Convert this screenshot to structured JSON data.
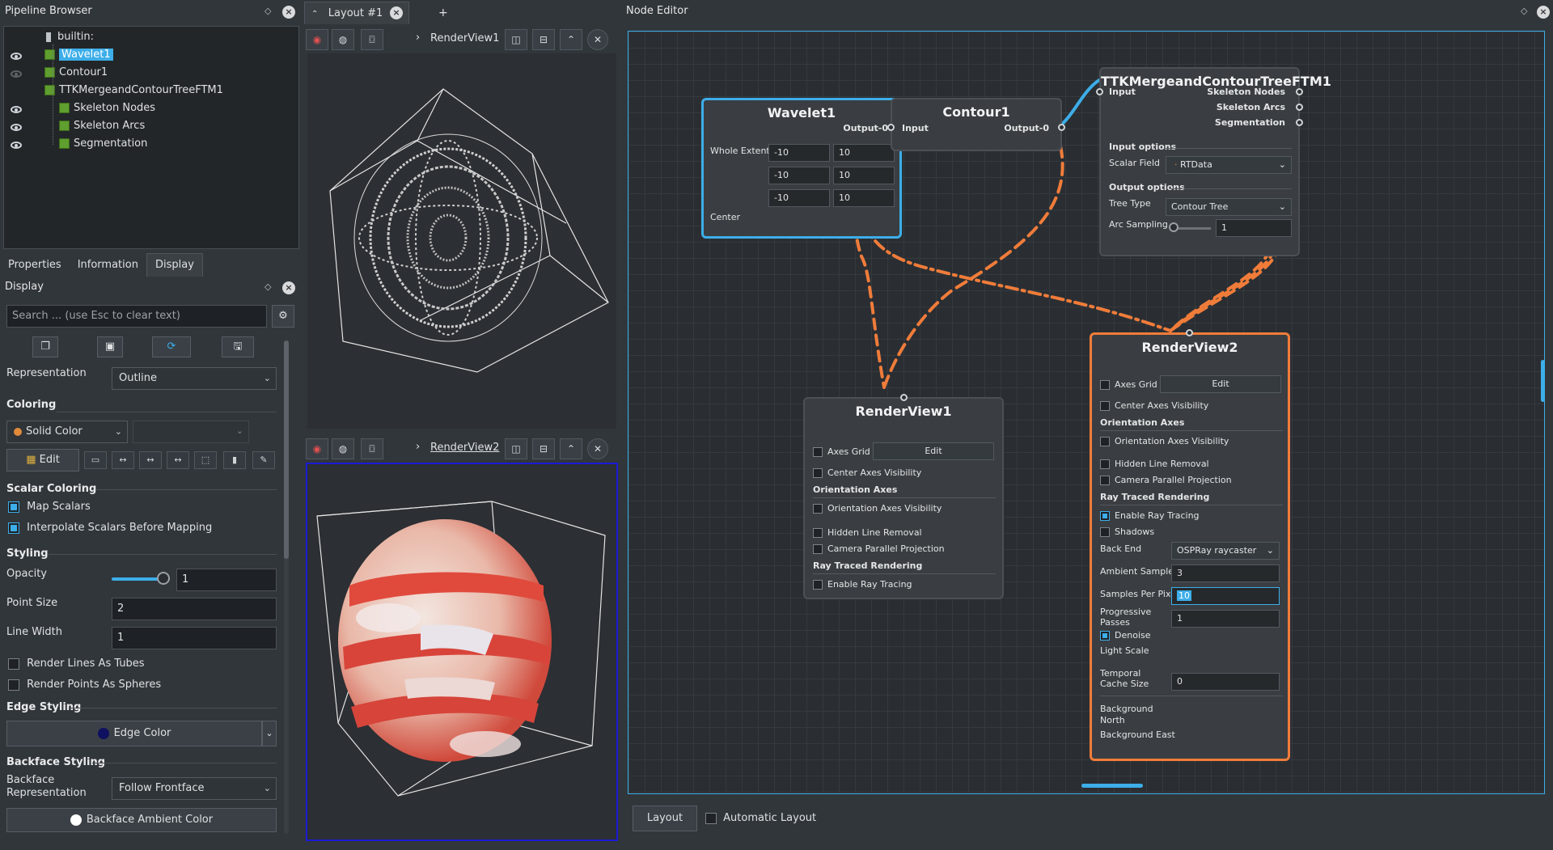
{
  "pipeline": {
    "title": "Pipeline Browser",
    "items": [
      {
        "label": "builtin:"
      },
      {
        "label": "Wavelet1"
      },
      {
        "label": "Contour1"
      },
      {
        "label": "TTKMergeandContourTreeFTM1"
      },
      {
        "label": "Skeleton Nodes"
      },
      {
        "label": "Skeleton Arcs"
      },
      {
        "label": "Segmentation"
      }
    ]
  },
  "prop_tabs": [
    "Properties",
    "Information",
    "Display"
  ],
  "display": {
    "title": "Display",
    "search_placeholder": "Search ... (use Esc to clear text)",
    "representation_label": "Representation",
    "representation_value": "Outline",
    "coloring_section": "Coloring",
    "coloring_value": "Solid Color",
    "edit_label": "Edit",
    "scalar_section": "Scalar Coloring",
    "map_scalars": "Map Scalars",
    "interpolate": "Interpolate Scalars Before Mapping",
    "styling_section": "Styling",
    "opacity_label": "Opacity",
    "opacity_value": "1",
    "opacity_level": 1.0,
    "point_size_label": "Point Size",
    "point_size_value": "2",
    "line_width_label": "Line Width",
    "line_width_value": "1",
    "lines_tubes": "Render Lines As Tubes",
    "points_spheres": "Render Points As Spheres",
    "edge_section": "Edge Styling",
    "edge_color": "Edge Color",
    "backface_section": "Backface Styling",
    "backface_rep_label": "Backface Representation",
    "backface_rep_value": "Follow Frontface",
    "backface_ambient": "Backface Ambient Color"
  },
  "layout": {
    "tab_label": "Layout #1",
    "add_tab": "+",
    "view1_name": "RenderView1",
    "view2_name": "RenderView2"
  },
  "node_editor": {
    "title": "Node Editor",
    "layout_button": "Layout",
    "auto_layout": "Automatic Layout",
    "wavelet": {
      "title": "Wavelet1",
      "output": "Output-0",
      "whole_extent": "Whole Extent",
      "extent": [
        "-10",
        "10",
        "-10",
        "10",
        "-10",
        "10"
      ],
      "center": "Center"
    },
    "contour": {
      "title": "Contour1",
      "input": "Input",
      "output": "Output-0"
    },
    "ttk": {
      "title": "TTKMergeandContourTreeFTM1",
      "input": "Input",
      "outputs": [
        "Skeleton Nodes",
        "Skeleton Arcs",
        "Segmentation"
      ],
      "input_options": "Input options",
      "scalar_field_label": "Scalar Field",
      "scalar_field_value": "RTData",
      "output_options": "Output options",
      "tree_type_label": "Tree Type",
      "tree_type_value": "Contour Tree",
      "arc_sampling_label": "Arc Sampling",
      "arc_sampling_value": "1"
    },
    "rv1": {
      "title": "RenderView1",
      "axes_grid": "Axes Grid",
      "edit": "Edit",
      "center_axes": "Center Axes Visibility",
      "orientation_section": "Orientation Axes",
      "orientation_vis": "Orientation Axes Visibility",
      "hidden_line": "Hidden Line Removal",
      "camera_parallel": "Camera Parallel Projection",
      "ray_section": "Ray Traced Rendering",
      "enable_ray": "Enable Ray Tracing"
    },
    "rv2": {
      "title": "RenderView2",
      "axes_grid": "Axes Grid",
      "edit": "Edit",
      "center_axes": "Center Axes Visibility",
      "orientation_section": "Orientation Axes",
      "orientation_vis": "Orientation Axes Visibility",
      "hidden_line": "Hidden Line Removal",
      "camera_parallel": "Camera Parallel Projection",
      "ray_section": "Ray Traced Rendering",
      "enable_ray": "Enable Ray Tracing",
      "shadows": "Shadows",
      "back_end_label": "Back End",
      "back_end_value": "OSPRay raycaster",
      "ambient_label": "Ambient Samples",
      "ambient_value": "3",
      "spp_label": "Samples Per Pixel",
      "spp_value": "10",
      "progressive_label": "Progressive Passes",
      "progressive_value": "1",
      "denoise": "Denoise",
      "light_scale": "Light Scale",
      "temporal_label": "Temporal Cache Size",
      "temporal_value": "0",
      "bg_north": "Background North",
      "bg_east": "Background East"
    }
  },
  "colors": {
    "accent": "#3daee9",
    "wavelet_border": "#3daee9",
    "rv2_border": "#f07c3a",
    "link_orange": "#f07c3a",
    "active_view_border": "#1a1ad6"
  }
}
